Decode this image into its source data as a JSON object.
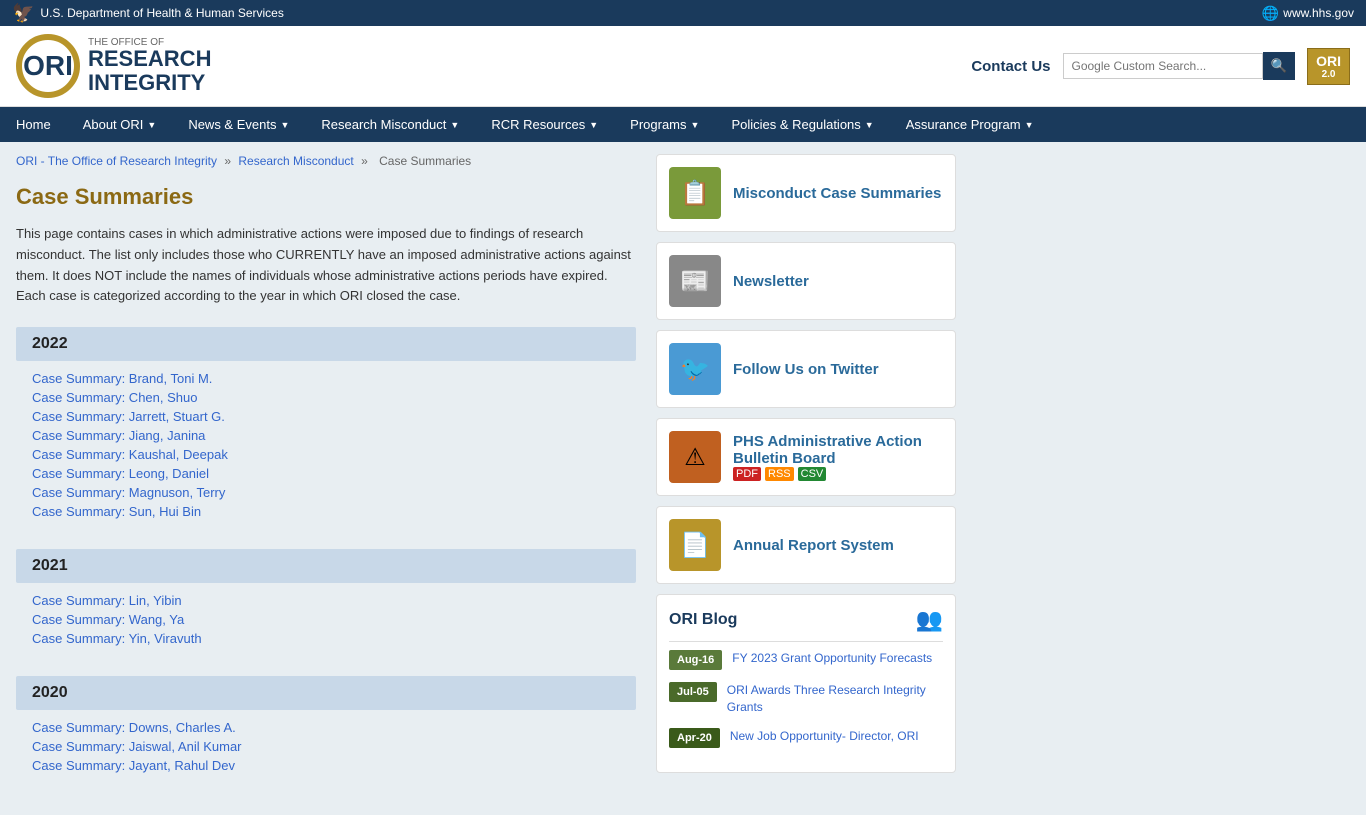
{
  "topbar": {
    "left_text": "U.S. Department of Health & Human Services",
    "right_text": "www.hhs.gov"
  },
  "header": {
    "logo_letters": "ORI",
    "office_of": "THE OFFICE OF",
    "research": "RESEARCH",
    "integrity": "INTEGRITY",
    "contact_us": "Contact Us",
    "search_placeholder": "Google Custom Search...",
    "badge_top": "ORI",
    "badge_sub": "2.0"
  },
  "nav": {
    "items": [
      {
        "label": "Home",
        "has_arrow": false
      },
      {
        "label": "About ORI",
        "has_arrow": true
      },
      {
        "label": "News & Events",
        "has_arrow": true
      },
      {
        "label": "Research Misconduct",
        "has_arrow": true
      },
      {
        "label": "RCR Resources",
        "has_arrow": true
      },
      {
        "label": "Programs",
        "has_arrow": true
      },
      {
        "label": "Policies & Regulations",
        "has_arrow": true
      },
      {
        "label": "Assurance Program",
        "has_arrow": true
      }
    ]
  },
  "breadcrumb": {
    "home": "ORI - The Office of Research Integrity",
    "sep1": "»",
    "level2": "Research Misconduct",
    "sep2": "»",
    "current": "Case Summaries"
  },
  "page_title": "Case Summaries",
  "description": "This page contains cases in which administrative actions were imposed due to findings of research misconduct. The list only includes those who CURRENTLY have an imposed administrative actions against them. It does NOT include the names of individuals whose administrative actions periods have expired. Each case is categorized according to the year in which ORI closed the case.",
  "years": [
    {
      "year": "2022",
      "cases": [
        "Case Summary: Brand, Toni M.",
        "Case Summary: Chen, Shuo",
        "Case Summary: Jarrett, Stuart G.",
        "Case Summary: Jiang, Janina",
        "Case Summary: Kaushal, Deepak",
        "Case Summary: Leong, Daniel",
        "Case Summary: Magnuson, Terry",
        "Case Summary: Sun, Hui Bin"
      ]
    },
    {
      "year": "2021",
      "cases": [
        "Case Summary: Lin, Yibin",
        "Case Summary: Wang, Ya",
        "Case Summary: Yin, Viravuth"
      ]
    },
    {
      "year": "2020",
      "cases": [
        "Case Summary: Downs, Charles A.",
        "Case Summary: Jaiswal, Anil Kumar",
        "Case Summary: Jayant, Rahul Dev"
      ]
    }
  ],
  "sidebar": {
    "cards": [
      {
        "id": "misconduct",
        "title": "Misconduct Case Summaries",
        "icon": "📋",
        "icon_class": "icon-green"
      },
      {
        "id": "newsletter",
        "title": "Newsletter",
        "icon": "📰",
        "icon_class": "icon-gray"
      },
      {
        "id": "twitter",
        "title": "Follow Us on Twitter",
        "icon": "🐦",
        "icon_class": "icon-blue"
      },
      {
        "id": "phs",
        "title": "PHS Administrative Action Bulletin Board",
        "icon": "⚠",
        "icon_class": "icon-orange",
        "has_badges": true
      },
      {
        "id": "annual",
        "title": "Annual Report System",
        "icon": "📄",
        "icon_class": "icon-tan"
      }
    ]
  },
  "blog": {
    "title": "ORI Blog",
    "entries": [
      {
        "date": "Aug-16",
        "date_class": "aug",
        "title": "FY 2023 Grant Opportunity Forecasts"
      },
      {
        "date": "Jul-05",
        "date_class": "jul",
        "title": "ORI Awards Three Research Integrity Grants"
      },
      {
        "date": "Apr-20",
        "date_class": "apr",
        "title": "New Job Opportunity- Director, ORI"
      }
    ]
  }
}
